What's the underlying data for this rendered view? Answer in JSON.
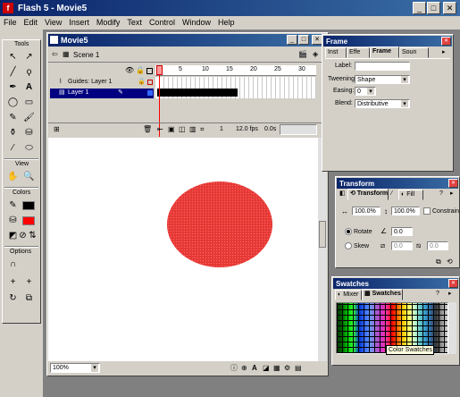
{
  "app": {
    "title": "Flash 5 - Movie5",
    "menu": [
      "File",
      "Edit",
      "View",
      "Insert",
      "Modify",
      "Text",
      "Control",
      "Window",
      "Help"
    ]
  },
  "toolbox": {
    "tools_label": "Tools",
    "view_label": "View",
    "colors_label": "Colors",
    "options_label": "Options",
    "colors": {
      "stroke": "#000000",
      "fill": "#ff0000"
    }
  },
  "movie": {
    "title": "Movie5",
    "scene": "Scene 1",
    "layers": [
      {
        "name": "Guides: Layer 1",
        "selected": false
      },
      {
        "name": "Layer 1",
        "selected": true
      }
    ],
    "ruler_ticks": [
      "1",
      "5",
      "10",
      "15",
      "20",
      "25",
      "30"
    ],
    "status": {
      "frame": "1",
      "fps": "12.0 fps",
      "time": "0.0s"
    },
    "zoom": "100%",
    "circle_color": "#e53935"
  },
  "frame_panel": {
    "title": "Frame",
    "tabs": [
      "Inst",
      "Effe",
      "Frame",
      "Soun"
    ],
    "label_field": "Label:",
    "tweening_label": "Tweening:",
    "tweening_value": "Shape",
    "easing_label": "Easing:",
    "easing_value": "0",
    "blend_label": "Blend:",
    "blend_value": "Distributive"
  },
  "transform_panel": {
    "title": "Transform",
    "tabs": [
      "Transform",
      "Fill"
    ],
    "width": "100.0%",
    "height": "100.0%",
    "constrain": "Constrain",
    "rotate_label": "Rotate",
    "rotate_value": "0.0",
    "skew_label": "Skew",
    "skew_h": "0.0",
    "skew_v": "0.0"
  },
  "swatches_panel": {
    "title": "Swatches",
    "tabs": [
      "Mixer",
      "Swatches"
    ],
    "tooltip": "Color Swatches"
  }
}
